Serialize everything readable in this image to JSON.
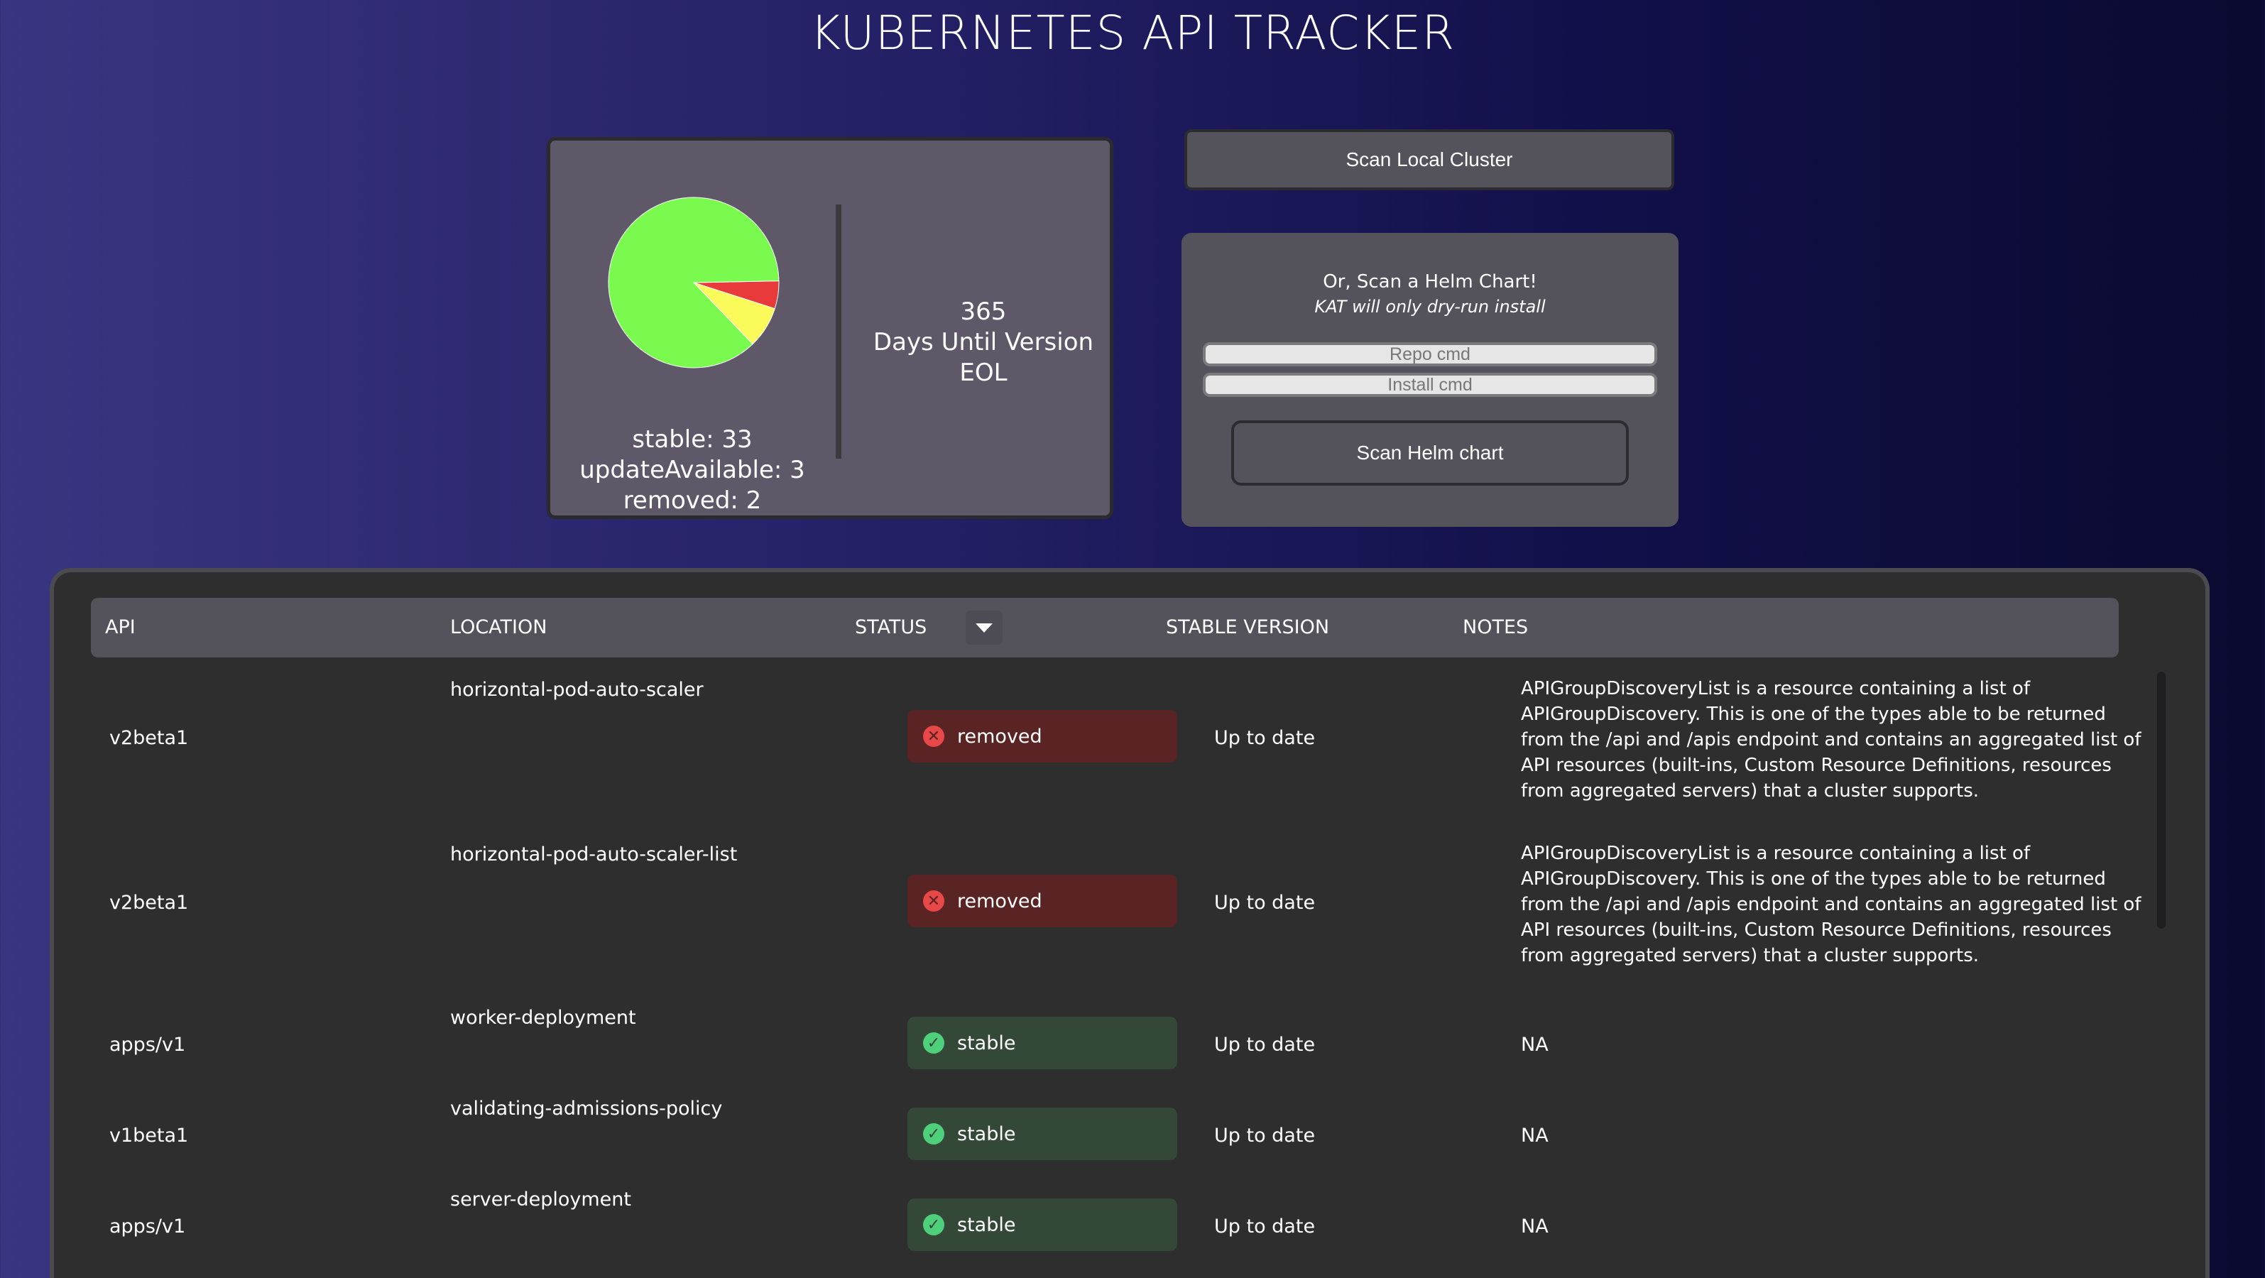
{
  "header": {
    "title": "KUBERNETES API TRACKER"
  },
  "summary": {
    "stable_label": "stable: 33",
    "update_label": "updateAvailable: 3",
    "removed_label": "removed: 2",
    "eol_days": "365",
    "eol_label": "Days Until Version EOL"
  },
  "chart_data": {
    "type": "pie",
    "categories": [
      "stable",
      "updateAvailable",
      "removed"
    ],
    "values": [
      33,
      3,
      2
    ],
    "colors": [
      "#7afa4e",
      "#fafa5a",
      "#e83a3a"
    ]
  },
  "actions": {
    "scan_local": "Scan Local Cluster",
    "helm_title": "Or, Scan a Helm Chart!",
    "helm_sub": "KAT will only dry-run install",
    "repo_placeholder": "Repo cmd",
    "install_placeholder": "Install cmd",
    "scan_helm": "Scan Helm chart"
  },
  "table": {
    "columns": [
      "API",
      "LOCATION",
      "STATUS",
      "STABLE VERSION",
      "NOTES"
    ],
    "rows": [
      {
        "api": "v2beta1",
        "location": "horizontal-pod-auto-scaler",
        "status": "removed",
        "stable_version": "Up to date",
        "notes": "APIGroupDiscoveryList is a resource containing a list of APIGroupDiscovery. This is one of the types able to be returned from the /api and /apis endpoint and contains an aggregated list of API resources (built-ins, Custom Resource Definitions, resources from aggregated servers) that a cluster supports."
      },
      {
        "api": "v2beta1",
        "location": "horizontal-pod-auto-scaler-list",
        "status": "removed",
        "stable_version": "Up to date",
        "notes": "APIGroupDiscoveryList is a resource containing a list of APIGroupDiscovery. This is one of the types able to be returned from the /api and /apis endpoint and contains an aggregated list of API resources (built-ins, Custom Resource Definitions, resources from aggregated servers) that a cluster supports."
      },
      {
        "api": "apps/v1",
        "location": "worker-deployment",
        "status": "stable",
        "stable_version": "Up to date",
        "notes": "NA"
      },
      {
        "api": "v1beta1",
        "location": "validating-admissions-policy",
        "status": "stable",
        "stable_version": "Up to date",
        "notes": "NA"
      },
      {
        "api": "apps/v1",
        "location": "server-deployment",
        "status": "stable",
        "stable_version": "Up to date",
        "notes": "NA"
      }
    ]
  }
}
